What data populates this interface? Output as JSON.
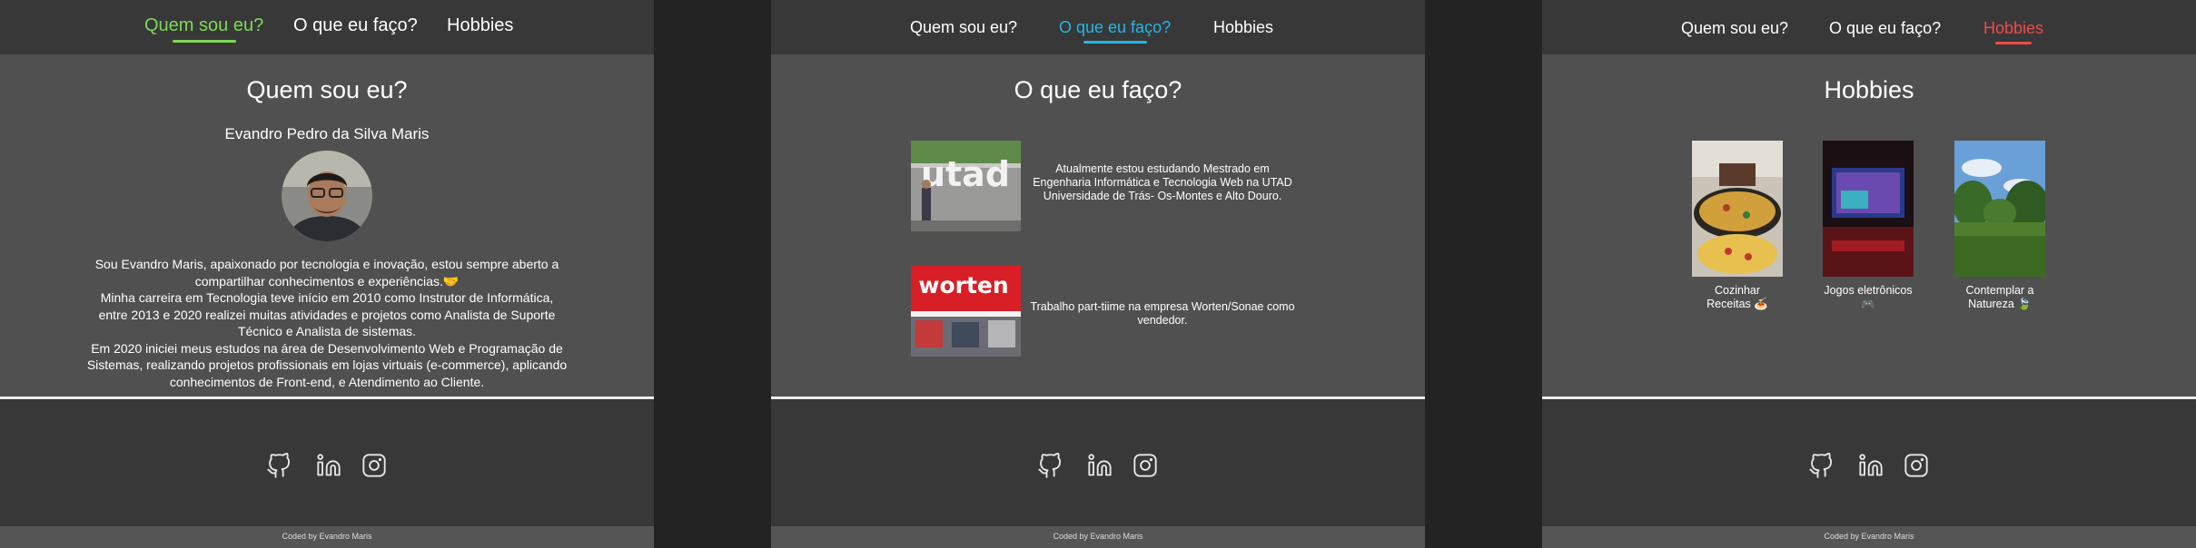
{
  "nav": {
    "about_label": "Quem sou eu?",
    "work_label": "O que eu faço?",
    "hobbies_label": "Hobbies"
  },
  "colors": {
    "active_about": "#7ed957",
    "active_work": "#22b8e6",
    "active_hobbies": "#ee4b4b"
  },
  "about": {
    "title": "Quem sou eu?",
    "name": "Evandro Pedro da Silva Maris",
    "paragraph1": "Sou Evandro Maris, apaixonado por tecnologia e inovação, estou sempre aberto a compartilhar conhecimentos e experiências.🤝",
    "paragraph2": "Minha carreira em Tecnologia teve início em 2010 como Instrutor de Informática, entre 2013 e 2020 realizei muitas atividades e projetos como Analista de Suporte Técnico e Analista de sistemas.",
    "paragraph3": "Em 2020 iniciei meus estudos na área de Desenvolvimento Web e Programação de Sistemas, realizando projetos profissionais em lojas virtuais (e-commerce), aplicando conhecimentos de Front-end, e Atendimento ao Cliente."
  },
  "work": {
    "title": "O que eu faço?",
    "utad_logo_text": "utad",
    "utad_text": "Atualmente estou estudando Mestrado em Engenharia Informática e Tecnologia Web na UTAD Universidade de Trás- Os-Montes e Alto Douro.",
    "worten_logo_text": "worten",
    "worten_text": "Trabalho part-tiime na empresa Worten/Sonae como vendedor."
  },
  "hobbies": {
    "title": "Hobbies",
    "items": [
      {
        "caption": "Cozinhar Receitas 🍝"
      },
      {
        "caption": "Jogos eletrônicos 🎮"
      },
      {
        "caption": "Contemplar a Natureza 🍃"
      }
    ]
  },
  "footer": {
    "credit": "Coded by Evandro Maris",
    "icons": [
      "github-icon",
      "linkedin-icon",
      "instagram-icon"
    ]
  }
}
